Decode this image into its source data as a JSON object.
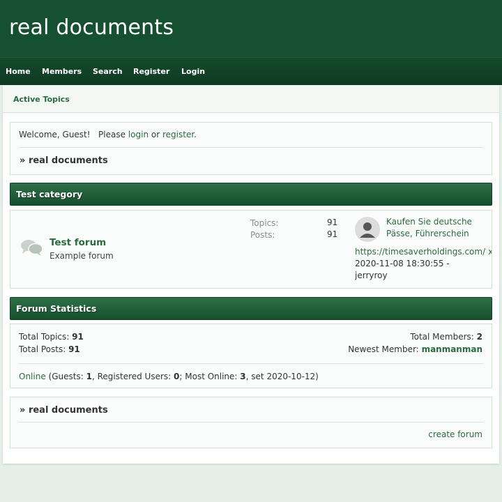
{
  "site": {
    "title": "real documents"
  },
  "nav": {
    "items": [
      "Home",
      "Members",
      "Search",
      "Register",
      "Login"
    ]
  },
  "breadcrumb": {
    "label": "Active Topics"
  },
  "welcome": {
    "prefix": "Welcome, Guest!",
    "please": "Please",
    "login": "login",
    "or": "or",
    "register": "register",
    "period": "."
  },
  "board_link": {
    "arrow": "»",
    "label": "real documents"
  },
  "category": {
    "title": "Test category",
    "forum": {
      "name": "Test forum",
      "description": "Example forum",
      "topics_label": "Topics:",
      "topics": "91",
      "posts_label": "Posts:",
      "posts": "91",
      "last_post": {
        "title_line1": "Kaufen Sie deutsche",
        "title_line2": "Pässe, Führerschein",
        "url": "https://timesaverholdings.com/ x",
        "date": "2020-11-08 18:30:55 -",
        "author": "jerryroy"
      }
    }
  },
  "stats": {
    "title": "Forum Statistics",
    "total_topics_label": "Total Topics:",
    "total_topics": "91",
    "total_posts_label": "Total Posts:",
    "total_posts": "91",
    "total_members_label": "Total Members:",
    "total_members": "2",
    "newest_member_label": "Newest Member:",
    "newest_member": "manmanman",
    "online_link": "Online",
    "guests_label": "(Guests:",
    "guests": "1",
    "registered_label": ", Registered Users:",
    "registered": "0",
    "most_online_label": "; Most Online:",
    "most_online": "3",
    "set_label": ", set 2020-10-12)"
  },
  "footer_panel": {
    "arrow": "»",
    "label": "real documents",
    "create_forum": "create forum"
  },
  "colors": {
    "header_bg": "#155131",
    "nav_bg": "#0e3a21",
    "category_bar": "#1f5f39",
    "link": "#2a6b3e",
    "page_bg": "#e4efe7"
  }
}
